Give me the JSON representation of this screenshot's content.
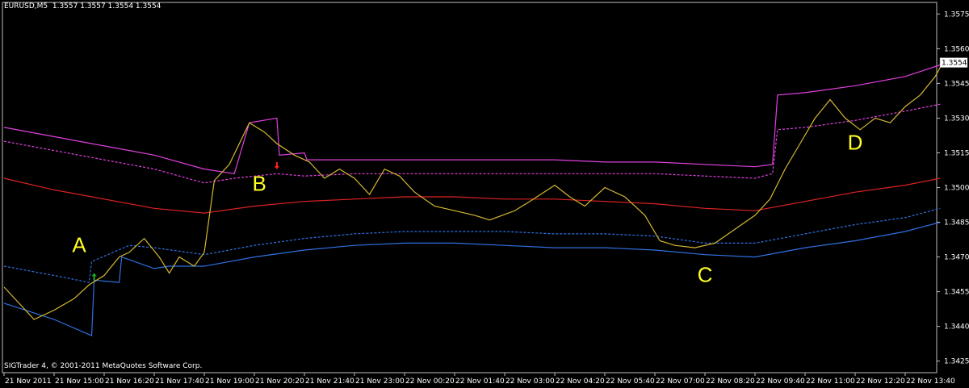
{
  "window": {
    "symbol_label": "EURUSD,M5",
    "ohlc_label": "1.3557 1.3557 1.3554 1.3554",
    "copyright": "SIGTrader 4, © 2001-2011 MetaQuotes Software Corp."
  },
  "chart_data": {
    "type": "line",
    "grid": false,
    "background": "#000000",
    "ylim": [
      1.342,
      1.358
    ],
    "y_ticks": [
      "1.3575",
      "1.3560",
      "1.3545",
      "1.3530",
      "1.3515",
      "1.3500",
      "1.3485",
      "1.3470",
      "1.3455",
      "1.3440",
      "1.3425"
    ],
    "current_price": "1.3554",
    "x_ticks": [
      "21 Nov 2011",
      "21 Nov 15:00",
      "21 Nov 16:20",
      "21 Nov 17:40",
      "21 Nov 19:00",
      "21 Nov 20:20",
      "21 Nov 21:40",
      "21 Nov 23:00",
      "22 Nov 00:20",
      "22 Nov 01:40",
      "22 Nov 03:00",
      "22 Nov 04:20",
      "22 Nov 05:40",
      "22 Nov 07:00",
      "22 Nov 08:20",
      "22 Nov 09:40",
      "22 Nov 11:00",
      "22 Nov 12:20",
      "22 Nov 13:40"
    ],
    "annotations": [
      {
        "label": "A",
        "x": 1.5,
        "y": 1.34722
      },
      {
        "label": "B",
        "x": 5.1,
        "y": 1.34986
      },
      {
        "label": "C",
        "x": 14.0,
        "y": 1.34592
      },
      {
        "label": "D",
        "x": 17.0,
        "y": 1.35163
      }
    ],
    "signals": [
      {
        "type": "buy",
        "x": 1.8,
        "y": 1.3461,
        "color": "#22aa22"
      },
      {
        "type": "sell",
        "x": 5.45,
        "y": 1.351,
        "color": "#ff2222"
      }
    ],
    "series": [
      {
        "color": "#e040e0",
        "style": "solid",
        "points": [
          [
            0,
            1.3526
          ],
          [
            1,
            1.3522
          ],
          [
            2,
            1.3518
          ],
          [
            3,
            1.3514
          ],
          [
            4,
            1.3508
          ],
          [
            4.6,
            1.3506
          ],
          [
            4.9,
            1.3528
          ],
          [
            5.45,
            1.353
          ],
          [
            5.5,
            1.3514
          ],
          [
            6.0,
            1.3515
          ],
          [
            6.05,
            1.3512
          ],
          [
            7,
            1.3512
          ],
          [
            8,
            1.3512
          ],
          [
            9,
            1.3512
          ],
          [
            10,
            1.3512
          ],
          [
            11,
            1.3512
          ],
          [
            12,
            1.3511
          ],
          [
            13,
            1.3511
          ],
          [
            14,
            1.351
          ],
          [
            15,
            1.3509
          ],
          [
            15.35,
            1.351
          ],
          [
            15.45,
            1.354
          ],
          [
            16,
            1.3541
          ],
          [
            17,
            1.3544
          ],
          [
            18,
            1.3548
          ],
          [
            18.7,
            1.3553
          ]
        ]
      },
      {
        "color": "#e040e0",
        "style": "dashed",
        "points": [
          [
            0,
            1.352
          ],
          [
            1,
            1.3516
          ],
          [
            2,
            1.3512
          ],
          [
            3,
            1.3508
          ],
          [
            4,
            1.3502
          ],
          [
            4.6,
            1.3504
          ],
          [
            5.45,
            1.3506
          ],
          [
            6,
            1.3505
          ],
          [
            7,
            1.3506
          ],
          [
            8,
            1.3506
          ],
          [
            9,
            1.3506
          ],
          [
            10,
            1.3506
          ],
          [
            11,
            1.3506
          ],
          [
            12,
            1.3506
          ],
          [
            13,
            1.3506
          ],
          [
            14,
            1.3505
          ],
          [
            15,
            1.3504
          ],
          [
            15.35,
            1.3506
          ],
          [
            15.45,
            1.3525
          ],
          [
            16,
            1.3526
          ],
          [
            17,
            1.3529
          ],
          [
            18,
            1.3533
          ],
          [
            18.7,
            1.3536
          ]
        ]
      },
      {
        "color": "#dd2222",
        "style": "solid",
        "points": [
          [
            0,
            1.3504
          ],
          [
            1,
            1.3499
          ],
          [
            2,
            1.3495
          ],
          [
            3,
            1.3491
          ],
          [
            4,
            1.3489
          ],
          [
            5,
            1.3492
          ],
          [
            6,
            1.3494
          ],
          [
            7,
            1.3495
          ],
          [
            8,
            1.3496
          ],
          [
            9,
            1.3496
          ],
          [
            10,
            1.3495
          ],
          [
            11,
            1.3495
          ],
          [
            12,
            1.3494
          ],
          [
            13,
            1.3493
          ],
          [
            14,
            1.3491
          ],
          [
            15,
            1.349
          ],
          [
            16,
            1.3494
          ],
          [
            17,
            1.3498
          ],
          [
            18,
            1.3501
          ],
          [
            18.7,
            1.3504
          ]
        ]
      },
      {
        "color": "#3070e0",
        "style": "dashed",
        "points": [
          [
            0,
            1.3466
          ],
          [
            1,
            1.3462
          ],
          [
            1.7,
            1.3459
          ],
          [
            1.75,
            1.3468
          ],
          [
            2.5,
            1.3475
          ],
          [
            3,
            1.3474
          ],
          [
            4,
            1.3471
          ],
          [
            5,
            1.3475
          ],
          [
            6,
            1.3478
          ],
          [
            7,
            1.348
          ],
          [
            8,
            1.3481
          ],
          [
            9,
            1.3481
          ],
          [
            10,
            1.3481
          ],
          [
            11,
            1.348
          ],
          [
            12,
            1.348
          ],
          [
            13,
            1.3479
          ],
          [
            14,
            1.3476
          ],
          [
            15,
            1.3476
          ],
          [
            16,
            1.348
          ],
          [
            17,
            1.3484
          ],
          [
            18,
            1.3487
          ],
          [
            18.7,
            1.3491
          ]
        ]
      },
      {
        "color": "#3070e0",
        "style": "solid",
        "points": [
          [
            0,
            1.345
          ],
          [
            1,
            1.3443
          ],
          [
            1.75,
            1.3436
          ],
          [
            1.8,
            1.346
          ],
          [
            2.3,
            1.3459
          ],
          [
            2.35,
            1.347
          ],
          [
            3,
            1.3465
          ],
          [
            3.3,
            1.3466
          ],
          [
            4,
            1.3466
          ],
          [
            5,
            1.347
          ],
          [
            6,
            1.3473
          ],
          [
            7,
            1.3475
          ],
          [
            8,
            1.3476
          ],
          [
            9,
            1.3476
          ],
          [
            10,
            1.3475
          ],
          [
            11,
            1.3474
          ],
          [
            12,
            1.3474
          ],
          [
            13,
            1.3473
          ],
          [
            14,
            1.3471
          ],
          [
            15,
            1.347
          ],
          [
            16,
            1.3474
          ],
          [
            17,
            1.3477
          ],
          [
            18,
            1.3481
          ],
          [
            18.7,
            1.3485
          ]
        ]
      },
      {
        "color": "#d4b830",
        "style": "solid",
        "points": [
          [
            0,
            1.3457
          ],
          [
            0.3,
            1.345
          ],
          [
            0.6,
            1.3443
          ],
          [
            1.0,
            1.3447
          ],
          [
            1.4,
            1.3452
          ],
          [
            1.7,
            1.3458
          ],
          [
            2.0,
            1.3462
          ],
          [
            2.3,
            1.347
          ],
          [
            2.5,
            1.3472
          ],
          [
            2.8,
            1.3478
          ],
          [
            3.1,
            1.347
          ],
          [
            3.3,
            1.3463
          ],
          [
            3.5,
            1.347
          ],
          [
            3.8,
            1.3466
          ],
          [
            4.0,
            1.3472
          ],
          [
            4.2,
            1.3503
          ],
          [
            4.5,
            1.351
          ],
          [
            4.9,
            1.3528
          ],
          [
            5.2,
            1.3524
          ],
          [
            5.45,
            1.3519
          ],
          [
            5.8,
            1.3514
          ],
          [
            6.1,
            1.3511
          ],
          [
            6.4,
            1.3504
          ],
          [
            6.7,
            1.3508
          ],
          [
            7.0,
            1.3504
          ],
          [
            7.3,
            1.3497
          ],
          [
            7.6,
            1.3508
          ],
          [
            7.9,
            1.3505
          ],
          [
            8.2,
            1.3498
          ],
          [
            8.6,
            1.3492
          ],
          [
            9.0,
            1.349
          ],
          [
            9.4,
            1.3488
          ],
          [
            9.7,
            1.3486
          ],
          [
            10.2,
            1.349
          ],
          [
            10.5,
            1.3494
          ],
          [
            11.0,
            1.3501
          ],
          [
            11.3,
            1.3496
          ],
          [
            11.6,
            1.3492
          ],
          [
            12.0,
            1.35
          ],
          [
            12.4,
            1.3496
          ],
          [
            12.8,
            1.3488
          ],
          [
            13.1,
            1.3477
          ],
          [
            13.4,
            1.3475
          ],
          [
            13.8,
            1.3474
          ],
          [
            14.2,
            1.3476
          ],
          [
            14.6,
            1.3482
          ],
          [
            15.0,
            1.3488
          ],
          [
            15.3,
            1.3495
          ],
          [
            15.6,
            1.3508
          ],
          [
            15.9,
            1.3519
          ],
          [
            16.2,
            1.353
          ],
          [
            16.5,
            1.3538
          ],
          [
            16.8,
            1.353
          ],
          [
            17.1,
            1.3525
          ],
          [
            17.4,
            1.353
          ],
          [
            17.7,
            1.3528
          ],
          [
            18.0,
            1.3535
          ],
          [
            18.3,
            1.354
          ],
          [
            18.6,
            1.3548
          ],
          [
            18.75,
            1.3554
          ]
        ]
      }
    ]
  }
}
